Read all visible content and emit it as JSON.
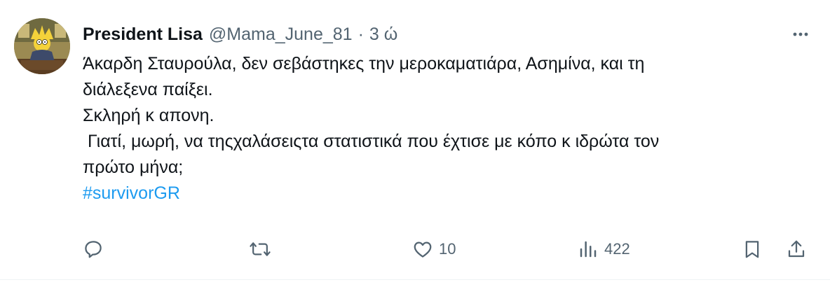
{
  "tweet": {
    "display_name": "President Lisa",
    "handle": "@Mama_June_81",
    "separator": "·",
    "time": "3 ώ",
    "more_label": "···",
    "body_lines": [
      "Άκαρδη Σταυρούλα, δεν σεβάστηκες την μεροκαματιάρα, Ασημίνα, και τη",
      "διάλεξενα παίξει.",
      "Σκληρή κ απονη.",
      " Γιατί, μωρή, να τηςχαλάσειςτα στατιστικά που έχτισε με κόπο κ ιδρώτα τον",
      "πρώτο μήνα;"
    ],
    "hashtag": "#survivorGR",
    "actions": {
      "reply_icon": "reply-icon",
      "retweet_icon": "retweet-icon",
      "like_icon": "like-icon",
      "like_count": "10",
      "views_icon": "views-icon",
      "views_count": "422",
      "bookmark_icon": "bookmark-icon",
      "share_icon": "share-icon"
    }
  },
  "colors": {
    "text_primary": "#0f1419",
    "text_secondary": "#536471",
    "link": "#1d9bf0",
    "border": "#eff3f4",
    "background": "#ffffff"
  }
}
